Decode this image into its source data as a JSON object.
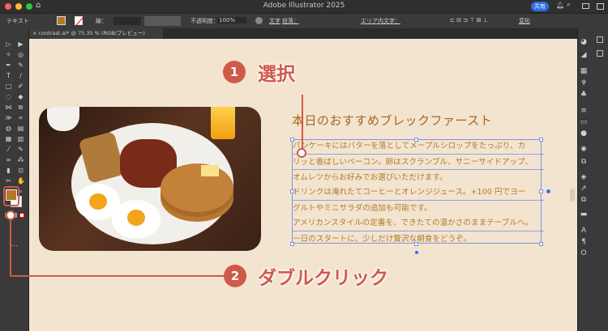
{
  "window": {
    "title": "Adobe Illustrator 2025",
    "share_label": "共有"
  },
  "control_bar": {
    "mode": "テキスト",
    "stroke_label": "線：",
    "opacity_label": "不透明度：",
    "opacity_value": "100%",
    "char_label": "文字",
    "para_label": "段落：",
    "area_type_label": "エリア内文字：",
    "transform_label": "変形",
    "fill_color": "#b57a26"
  },
  "document_tab": {
    "title": "contrast.ai* @ 75.35 % (RGB/プレビュー)"
  },
  "artboard": {
    "heading": "本日のおすすめブレックファースト",
    "lines": [
      "パンケーキにはバターを落としてメープルシロップをたっぷり、カ",
      "リッと香ばしいベーコン。卵はスクランブル、サニーサイドアップ、",
      "オムレツからお好みでお選びいただけます。",
      "ドリンクは淹れたてコーヒーとオレンジジュース。+100 円でヨー",
      "グルトやミニサラダの追加も可能です。",
      "アメリカンスタイルの定番を、できたての温かさのままテーブルへ。",
      "一日のスタートに、少しだけ贅沢な朝食をどうぞ。"
    ],
    "text_color": "#b07a2a"
  },
  "annotations": [
    {
      "number": "1",
      "label": "選択"
    },
    {
      "number": "2",
      "label": "ダブルクリック"
    }
  ],
  "accent_color": "#d05a4a"
}
